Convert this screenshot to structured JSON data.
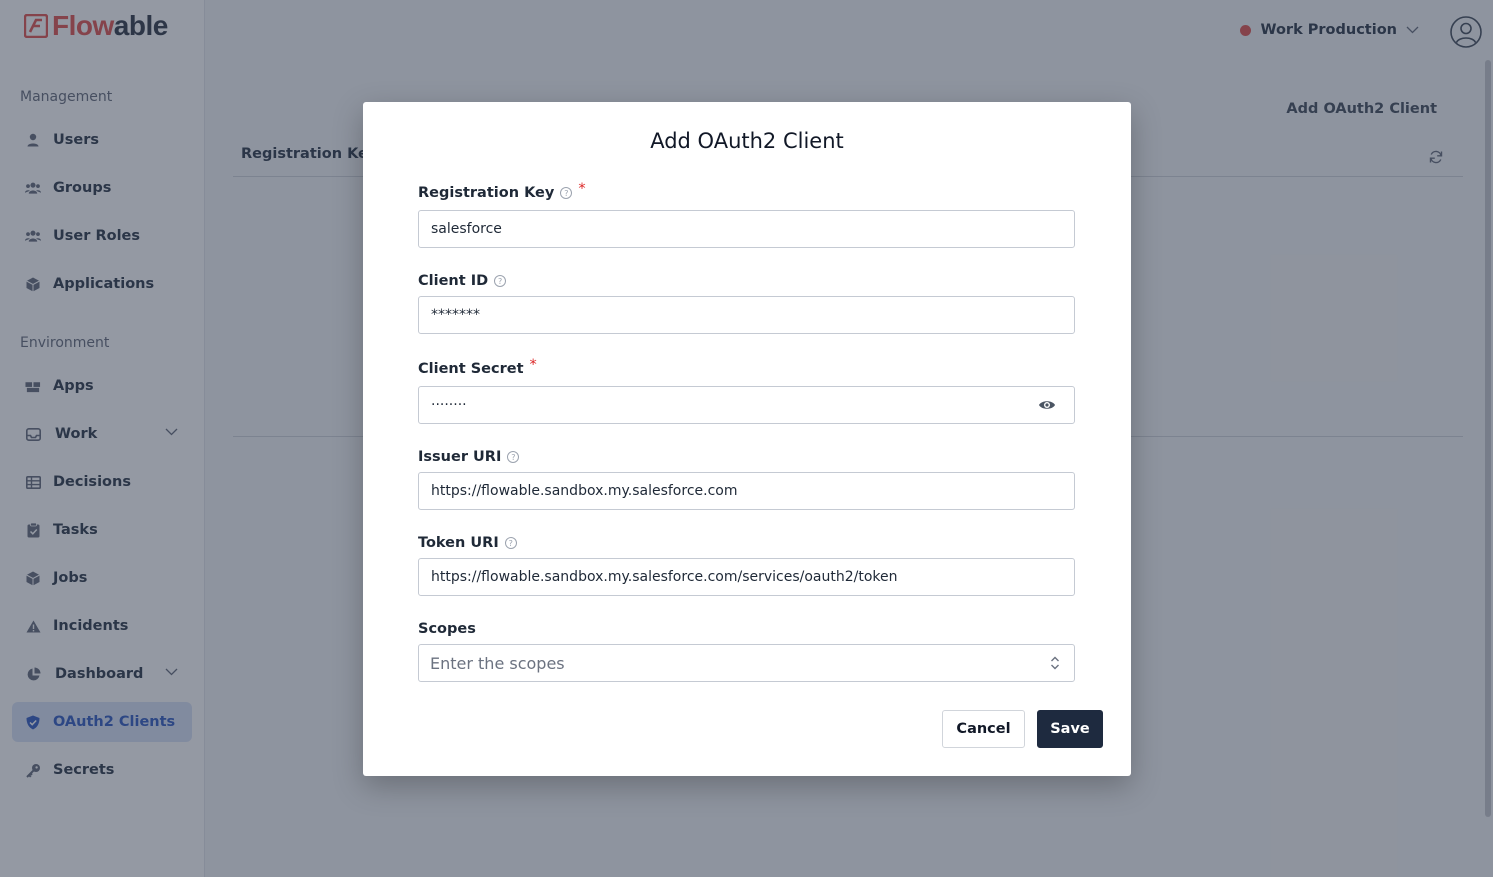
{
  "brand": {
    "logo_text_part1": "Flow",
    "logo_text_part2": "able",
    "accent_color": "#e25b57"
  },
  "sidebar": {
    "sections": [
      {
        "title": "Management"
      },
      {
        "title": "Environment"
      }
    ],
    "items": [
      {
        "label": "Users",
        "icon": "user-icon"
      },
      {
        "label": "Groups",
        "icon": "users-icon"
      },
      {
        "label": "User Roles",
        "icon": "users-icon"
      },
      {
        "label": "Applications",
        "icon": "cube-icon"
      },
      {
        "label": "Apps",
        "icon": "boxes-icon"
      },
      {
        "label": "Work",
        "icon": "inbox-icon",
        "expandable": true
      },
      {
        "label": "Decisions",
        "icon": "table-icon"
      },
      {
        "label": "Tasks",
        "icon": "clipboard-icon"
      },
      {
        "label": "Jobs",
        "icon": "cube-icon"
      },
      {
        "label": "Incidents",
        "icon": "warning-icon"
      },
      {
        "label": "Dashboard",
        "icon": "pie-chart-icon",
        "expandable": true
      },
      {
        "label": "OAuth2 Clients",
        "icon": "shield-check-icon",
        "active": true
      },
      {
        "label": "Secrets",
        "icon": "key-icon"
      }
    ]
  },
  "header": {
    "environment": "Work Production",
    "environment_status_color": "#e25b57"
  },
  "page": {
    "add_button": "Add OAuth2 Client",
    "table_columns": [
      "Registration Key"
    ]
  },
  "modal": {
    "title": "Add OAuth2 Client",
    "fields": {
      "registration_key": {
        "label": "Registration Key",
        "value": "salesforce",
        "required": true,
        "help": true
      },
      "client_id": {
        "label": "Client ID",
        "value": "*******",
        "help": true
      },
      "client_secret": {
        "label": "Client Secret",
        "value": "········",
        "required": true
      },
      "issuer_uri": {
        "label": "Issuer URI",
        "value": "https://flowable.sandbox.my.salesforce.com",
        "help": true
      },
      "token_uri": {
        "label": "Token URI",
        "value": "https://flowable.sandbox.my.salesforce.com/services/oauth2/token",
        "help": true
      },
      "scopes": {
        "label": "Scopes",
        "placeholder": "Enter the scopes"
      }
    },
    "required_marker": "*",
    "help_glyph": "?",
    "cancel_label": "Cancel",
    "save_label": "Save"
  }
}
